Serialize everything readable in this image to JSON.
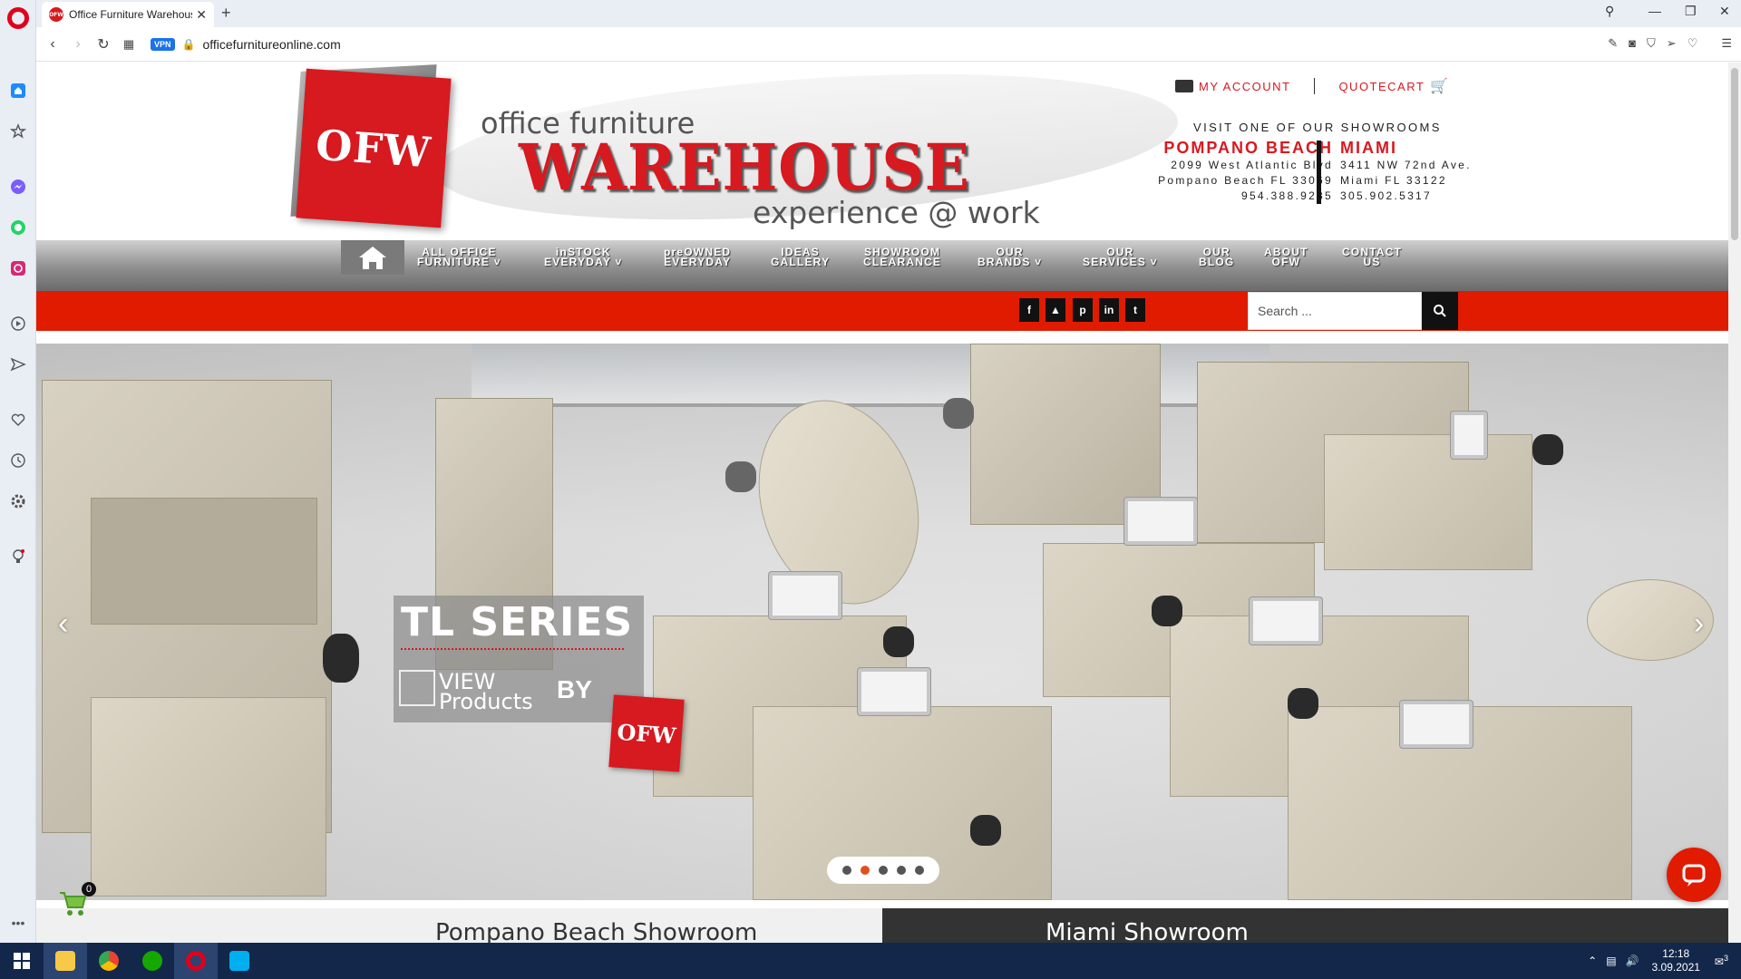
{
  "browser": {
    "tab_title": "Office Furniture Warehouse",
    "tab_favicon_text": "OFW",
    "new_tab": "+",
    "url": "officefurnitureonline.com",
    "vpn_label": "VPN"
  },
  "header": {
    "logo_text": "OFW",
    "brand_top": "office furniture",
    "brand_main": "WAREHOUSE",
    "brand_tagline": "experience @ work",
    "my_account": "MY ACCOUNT",
    "quotecart": "QUOTECART",
    "visit_text": "VISIT ONE OF OUR SHOWROOMS",
    "locations": [
      {
        "name": "POMPANO BEACH",
        "address": "2099 West Atlantic Blvd",
        "city": "Pompano Beach FL 33069",
        "phone": "954.388.9235"
      },
      {
        "name": "MIAMI",
        "address": "3411 NW 72nd Ave.",
        "city": "Miami FL 33122",
        "phone": "305.902.5317"
      }
    ]
  },
  "nav": {
    "items": [
      {
        "line1": "ALL OFFICE",
        "line2": "FURNITURE ˅"
      },
      {
        "line1": "inSTOCK",
        "line2": "EVERYDAY ˅"
      },
      {
        "line1": "preOWNED",
        "line2": "EVERYDAY"
      },
      {
        "line1": "IDEAS",
        "line2": "GALLERY"
      },
      {
        "line1": "SHOWROOM",
        "line2": "CLEARANCE"
      },
      {
        "line1": "OUR",
        "line2": "BRANDS ˅"
      },
      {
        "line1": "OUR",
        "line2": "SERVICES ˅"
      },
      {
        "line1": "OUR",
        "line2": "BLOG"
      },
      {
        "line1": "ABOUT",
        "line2": "OFW"
      },
      {
        "line1": "CONTACT",
        "line2": "US"
      }
    ]
  },
  "social": [
    "f",
    "▲",
    "p",
    "in",
    "t"
  ],
  "search": {
    "placeholder": "Search ..."
  },
  "hero": {
    "promo_title": "TL SERIES",
    "promo_view": "VIEW",
    "promo_products": "Products",
    "promo_by": "BY",
    "promo_logo": "OFW",
    "prev": "‹",
    "next": "›",
    "slides": 5,
    "active_slide": 2
  },
  "floating_cart": {
    "count": "0"
  },
  "showrooms": {
    "left": "Pompano Beach Showroom",
    "right": "Miami Showroom"
  },
  "taskbar": {
    "time": "12:18",
    "date": "3.09.2021",
    "notifications": "3"
  },
  "colors": {
    "brand_red": "#d71920",
    "nav_red": "#e01b00",
    "taskbar": "#13274b"
  }
}
